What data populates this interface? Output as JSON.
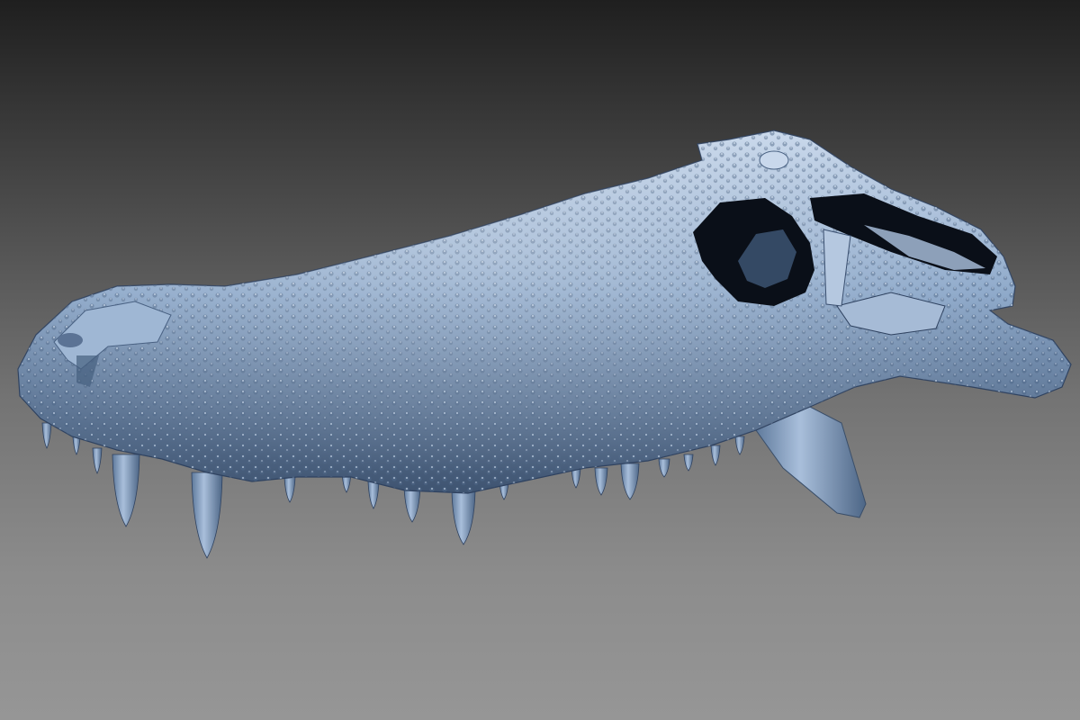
{
  "viewport": {
    "background_top": "#1f1f1f",
    "background_bottom": "#969696"
  },
  "model": {
    "subject": "crocodile-skull-3d-scan",
    "surface_color": "#8aa6c8",
    "highlight_color": "#c6d6ea",
    "shadow_color": "#3e5370",
    "cavity_color": "#0a0f18"
  }
}
